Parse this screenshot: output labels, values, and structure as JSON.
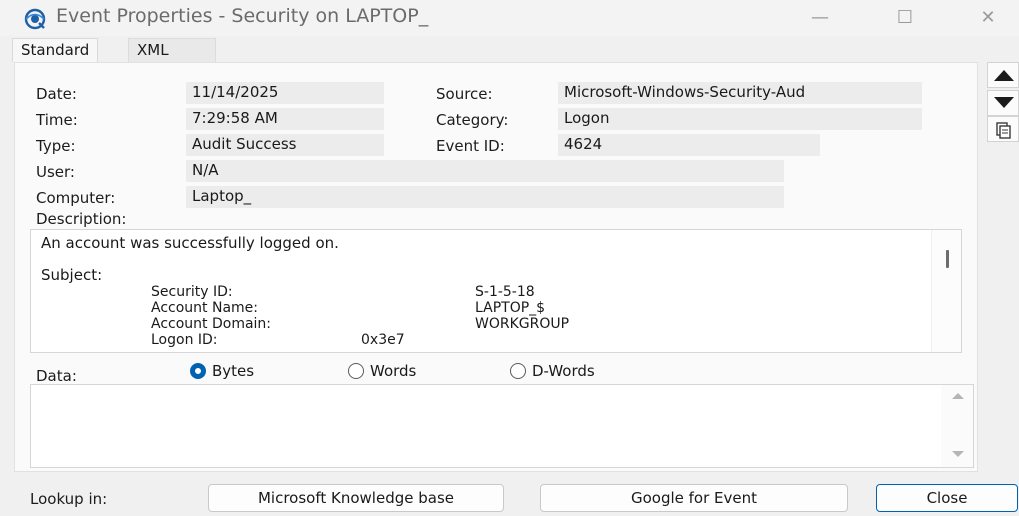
{
  "window": {
    "title": "Event Properties - Security on LAPTOP_",
    "controls": {
      "minimize": "—",
      "maximize": "☐",
      "close": "✕"
    }
  },
  "tabs": [
    {
      "label": "Standard",
      "active": true
    },
    {
      "label": "XML",
      "active": false
    }
  ],
  "fields": {
    "date": {
      "label": "Date:",
      "value": "11/14/2025"
    },
    "time": {
      "label": "Time:",
      "value": "7:29:58 AM"
    },
    "type": {
      "label": "Type:",
      "value": "Audit Success"
    },
    "user": {
      "label": "User:",
      "value": "N/A"
    },
    "computer": {
      "label": "Computer:",
      "value": "Laptop_"
    },
    "source": {
      "label": "Source:",
      "value": "Microsoft-Windows-Security-Aud"
    },
    "category": {
      "label": "Category:",
      "value": "Logon"
    },
    "event_id": {
      "label": "Event ID:",
      "value": "4624"
    }
  },
  "description": {
    "label": "Description:",
    "line1": "An account was successfully logged on.",
    "subject_label": "Subject:",
    "rows": [
      {
        "key": "Security ID:",
        "value": "S-1-5-18"
      },
      {
        "key": "Account Name:",
        "value": "LAPTOP_$"
      },
      {
        "key": "Account Domain:",
        "value": "WORKGROUP"
      },
      {
        "key": "Logon ID:",
        "value": "0x3e7"
      }
    ]
  },
  "data_section": {
    "label": "Data:",
    "options": [
      {
        "label": "Bytes",
        "selected": true
      },
      {
        "label": "Words",
        "selected": false
      },
      {
        "label": "D-Words",
        "selected": false
      }
    ]
  },
  "bottom": {
    "lookup_label": "Lookup in:",
    "kb_button": "Microsoft Knowledge base",
    "google_button": "Google for Event",
    "close_button": "Close"
  },
  "icons": {
    "title": "event-viewer-icon",
    "nav_up": "arrow-up-icon",
    "nav_down": "arrow-down-icon",
    "copy": "copy-icon"
  },
  "colors": {
    "accent": "#0063b1",
    "title_text": "#6b6b6b"
  }
}
